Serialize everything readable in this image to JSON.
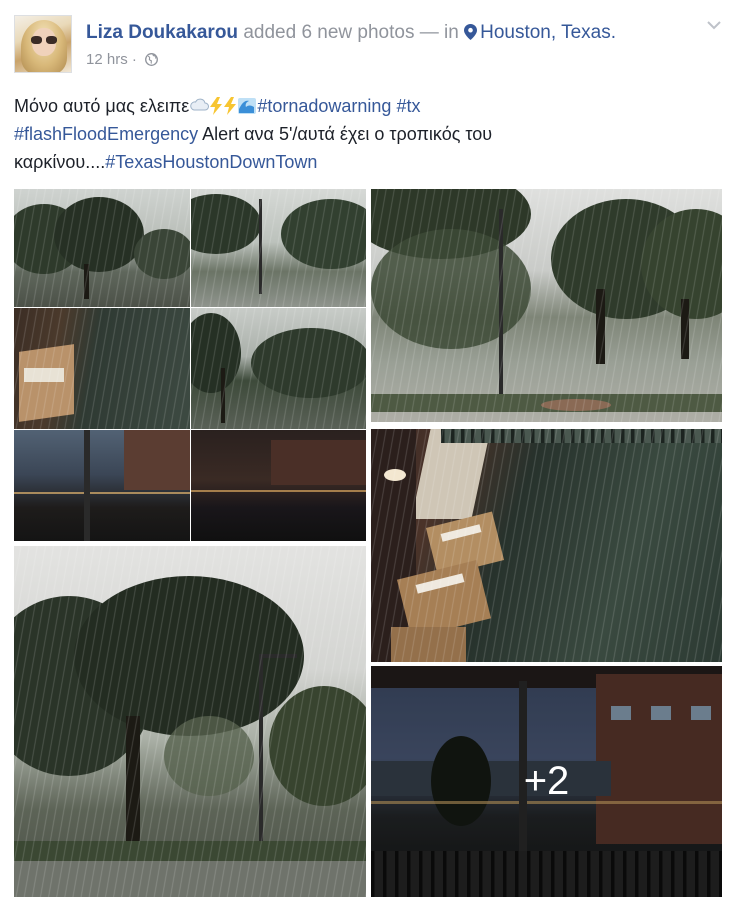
{
  "post": {
    "author_name": "Liza Doukakarou",
    "action_text": "added 6 new photos — in",
    "location": "Houston, Texas.",
    "timestamp": "12 hrs",
    "separator": "·"
  },
  "message": {
    "line1_text": "Μόνο αυτό μας ελειπε",
    "line1_tags": [
      "#tornadowarning",
      "#tx"
    ],
    "line2_tag": "#flashFloodEmergency",
    "line2_text": " Alert ανα 5'/αυτά έχει ο τροπικός του",
    "line3_text": "καρκίνου....",
    "line3_tag": "#TexasHoustonDownTown"
  },
  "gallery": {
    "more_count": "+2"
  },
  "colors": {
    "link": "#365899",
    "meta": "#90949c",
    "text": "#1d2129"
  },
  "icons": [
    "location-pin-icon",
    "globe-icon",
    "chevron-down-icon",
    "cloud-emoji",
    "lightning-emoji",
    "water-wave-emoji"
  ]
}
